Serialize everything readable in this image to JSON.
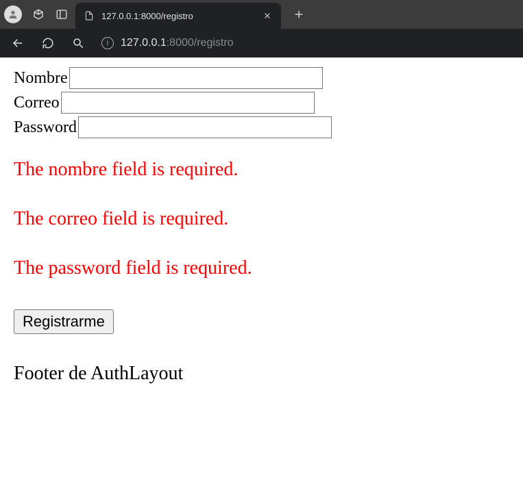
{
  "browser": {
    "tab_title": "127.0.0.1:8000/registro",
    "url_host": "127.0.0.1",
    "url_port": ":8000",
    "url_path": "/registro"
  },
  "form": {
    "nombre": {
      "label": "Nombre",
      "value": ""
    },
    "correo": {
      "label": "Correo",
      "value": ""
    },
    "password": {
      "label": "Password",
      "value": ""
    },
    "submit_label": "Registrarme"
  },
  "errors": [
    "The nombre field is required.",
    "The correo field is required.",
    "The password field is required."
  ],
  "footer": "Footer de AuthLayout"
}
